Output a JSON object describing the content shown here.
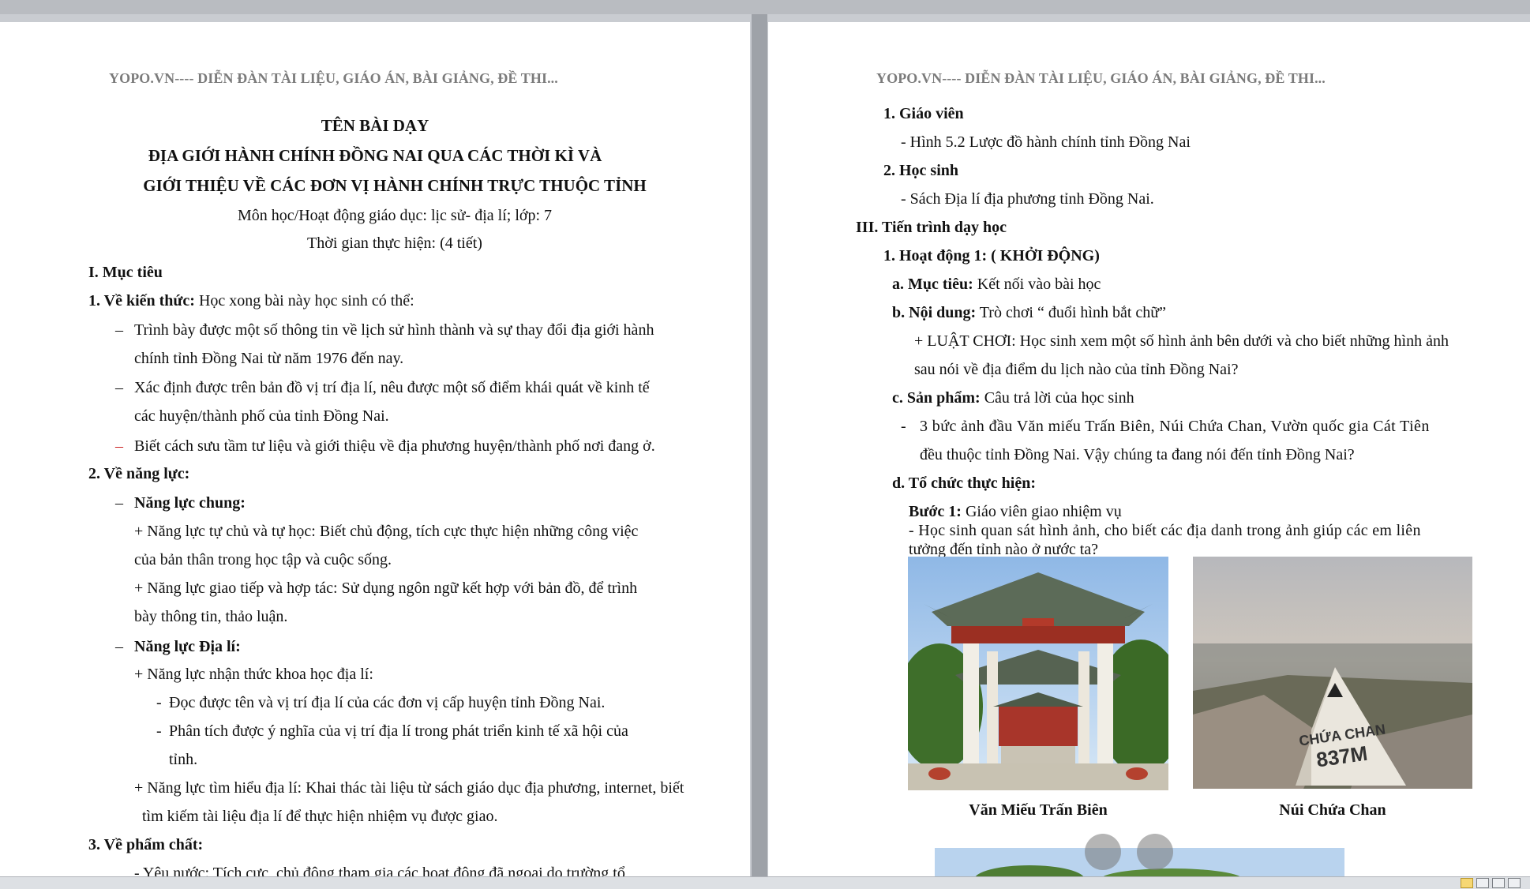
{
  "left_page": {
    "header": "YOPO.VN---- DIỄN ĐÀN TÀI LIỆU, GIÁO ÁN, BÀI GIẢNG, ĐỀ THI...",
    "title1": "TÊN BÀI DẠY",
    "title2": "ĐỊA GIỚI HÀNH CHÍNH ĐỒNG NAI QUA CÁC THỜI KÌ VÀ",
    "title3": "GIỚI THIỆU VỀ CÁC ĐƠN VỊ HÀNH CHÍNH TRỰC THUỘC TỈNH",
    "subject": "Môn học/Hoạt động giáo dục: lịc sử- địa lí; lớp: 7",
    "duration": "Thời gian thực hiện: (4 tiết)",
    "sec1": "I. Mục tiêu",
    "k1_label": "1. Về kiến thức:",
    "k1_text": " Học xong bài này học sinh có thể:",
    "dash": "–",
    "b1_l1": "Trình bày được một số thông tin về lịch sử hình thành và sự thay đổi địa giới hành",
    "b1_l2": "chính tỉnh Đồng Nai từ năm 1976 đến nay.",
    "b2_l1": "Xác định được trên bản đồ vị trí địa lí, nêu được một số điểm khái quát về kinh tế",
    "b2_l2": "các huyện/thành phố của tỉnh Đồng Nai.",
    "b3": "Biết cách sưu tầm tư liệu và giới thiệu về địa phương huyện/thành phố nơi đang ở.",
    "k2_label": "2. Về năng lực:",
    "nl_chung": "Năng lực chung:",
    "p1_l1": "+ Năng lực tự chủ và tự học: Biết chủ động, tích cực thực hiện những công việc",
    "p1_l2": "của bản thân trong học tập và cuộc sống.",
    "p2_l1": "+ Năng lực giao tiếp và hợp tác:  Sử dụng ngôn ngữ kết hợp với bản đồ, để trình",
    "p2_l2": "bày thông tin, thảo luận.",
    "nl_dia": "Năng lực Địa lí:",
    "p3": "+ Năng lực nhận thức khoa học địa lí:",
    "sdash": "-",
    "s1": "Đọc được tên và vị trí địa lí của các đơn vị cấp huyện tỉnh Đồng Nai.",
    "s2_l1": "Phân tích được ý nghĩa của vị trí địa lí trong phát triển kinh tế xã hội của",
    "s2_l2": "tỉnh.",
    "p4_l1": "+ Năng lực tìm hiểu địa lí: Khai thác tài liệu từ sách giáo dục địa phương, internet, biết",
    "p4_l2": "tìm kiếm tài liệu địa lí để thực hiện nhiệm vụ được giao.",
    "k3_label": "3. Về phẩm chất:",
    "last_line": "- Yêu nước: Tích cực, chủ động tham gia các hoạt động đã ngoại do trường tổ"
  },
  "right_page": {
    "header": "YOPO.VN---- DIỄN ĐÀN TÀI LIỆU, GIÁO ÁN, BÀI GIẢNG, ĐỀ THI...",
    "gv": "1. Giáo viên",
    "gv_item": "- Hình 5.2 Lược đồ hành chính tỉnh Đồng Nai",
    "hs": "2. Học sinh",
    "hs_item": "- Sách Địa lí địa phương tỉnh Đồng Nai.",
    "sec3": "III.  Tiến trình dạy học",
    "hd1": "1.  Hoạt động 1: ( KHỞI ĐỘNG)",
    "a_label": "a.  Mục tiêu:",
    "a_text": " Kết nối vào bài học",
    "b_label": "b.  Nội dung:",
    "b_text": " Trò chơi “ đuổi hình bắt chữ”",
    "rule_l1": "+ LUẬT CHƠI: Học sinh xem một số hình ảnh bên dưới và cho biết những hình ảnh",
    "rule_l2": "sau nói về địa điểm du lịch nào của tỉnh Đồng Nai?",
    "c_label": "c.  Sản phẩm:",
    "c_text": " Câu trả lời của học sinh",
    "ans_dash": "-",
    "ans_l1": "3  bức ảnh đầu Văn miếu Trấn Biên, Núi Chứa Chan, Vườn quốc gia Cát Tiên",
    "ans_l2": "đều thuộc tỉnh Đồng Nai. Vậy chúng ta đang nói đến tỉnh Đồng Nai?",
    "d_label": "d. Tổ chức thực hiện:",
    "step1_label": "Bước 1:",
    "step1_text": " Giáo viên giao nhiệm vụ",
    "q_l1": "- Học sinh quan sát hình ảnh, cho biết các địa danh trong ảnh giúp các em liên",
    "q_l2": "tưởng đến tỉnh nào ở nước ta?",
    "caption1": "Văn Miếu Trấn Biên",
    "caption2": "Núi Chứa Chan",
    "stone_l1": "CHỨA CHAN",
    "stone_l2": "837M"
  },
  "colors": {
    "header_gray": "#7b7b7b",
    "bullet_red": "#cc2222",
    "gutter": "#9ea2a8"
  }
}
